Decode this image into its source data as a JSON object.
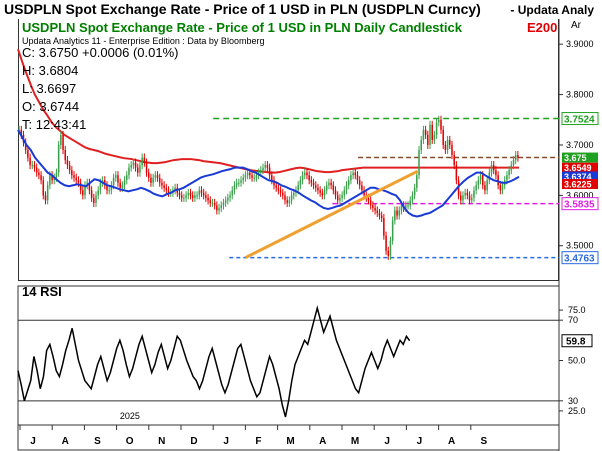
{
  "header": {
    "title": "USDPLN Spot Exchange Rate - Price of 1 USD in PLN (USDPLN Curncy)",
    "right_text": "- Updata Analy"
  },
  "chart": {
    "subtitle": "USDPLN Spot Exchange Rate - Price of 1 USD in PLN Daily Candlestick",
    "badge": "E200",
    "meta": "Updata Analytics 11 - Enterprise Edition : Data by Bloomberg",
    "corner": "Ar",
    "ohlc": [
      "C: 3.6750   +0.0006 (0.01%)",
      "H: 3.6804",
      "L: 3.6697",
      "O: 3.6744",
      "T: 12:43:41"
    ],
    "rsi_title": "14 RSI"
  },
  "colors": {
    "up": "#3aa04a",
    "down": "#e00000",
    "ma_fast": "#1a3ad6",
    "ma_slow": "#e02020",
    "trendline": "#f0a030",
    "resistance": "#20a020",
    "lower_resistance": "#8a4a2a",
    "support_magenta": "#e020e0",
    "support_blue": "#2a6ae0"
  },
  "chart_data": [
    {
      "type": "candlestick",
      "title": "USDPLN Spot Exchange Rate - Price of 1 USD in PLN Daily Candlestick",
      "ylim": [
        3.43,
        3.95
      ],
      "y_ticks": [
        3.5,
        3.6,
        3.7,
        3.8,
        3.9
      ],
      "y_tick_labels": [
        "3.5000",
        "3.6000",
        "3.7000",
        "3.8000",
        "3.9000"
      ],
      "x_months": [
        "J",
        "A",
        "S",
        "O",
        "N",
        "D",
        "J",
        "F",
        "M",
        "A",
        "M",
        "J",
        "J",
        "A",
        "S"
      ],
      "year_label": "2025",
      "levels": [
        {
          "name": "resistance",
          "value": 3.7524,
          "label": "3.7524"
        },
        {
          "name": "lower-resistance",
          "value": 3.675
        },
        {
          "name": "support-magenta",
          "value": 3.5835,
          "label": "3.5835"
        },
        {
          "name": "support-blue",
          "value": 3.4763,
          "label": "3.4763"
        }
      ],
      "price_labels": [
        {
          "value": "3.675",
          "color": "#20a020"
        },
        {
          "value": "3.6549",
          "color": "#e00000"
        },
        {
          "value": "3.6374",
          "color": "#1a3ad6"
        },
        {
          "value": "3.6225",
          "color": "#e00000"
        }
      ],
      "trendline": {
        "from": {
          "month_index": 7.0,
          "value": 3.4763
        },
        "to": {
          "month_index": 12.35,
          "value": 3.648
        }
      },
      "close_series": {
        "start_month_index": 0,
        "step_months": 0.045,
        "values": [
          3.73,
          3.72,
          3.705,
          3.69,
          3.675,
          3.66,
          3.66,
          3.655,
          3.645,
          3.64,
          3.63,
          3.6,
          3.59,
          3.62,
          3.64,
          3.63,
          3.635,
          3.645,
          3.7,
          3.72,
          3.69,
          3.67,
          3.66,
          3.65,
          3.64,
          3.635,
          3.63,
          3.625,
          3.61,
          3.6,
          3.62,
          3.625,
          3.61,
          3.595,
          3.585,
          3.6,
          3.61,
          3.625,
          3.63,
          3.62,
          3.61,
          3.61,
          3.62,
          3.635,
          3.64,
          3.625,
          3.615,
          3.62,
          3.63,
          3.64,
          3.655,
          3.66,
          3.665,
          3.655,
          3.645,
          3.66,
          3.675,
          3.665,
          3.645,
          3.635,
          3.625,
          3.635,
          3.64,
          3.635,
          3.625,
          3.62,
          3.615,
          3.61,
          3.605,
          3.605,
          3.61,
          3.615,
          3.605,
          3.6,
          3.595,
          3.595,
          3.6,
          3.605,
          3.6,
          3.595,
          3.6,
          3.6,
          3.61,
          3.605,
          3.6,
          3.595,
          3.59,
          3.585,
          3.585,
          3.58,
          3.57,
          3.575,
          3.58,
          3.585,
          3.59,
          3.595,
          3.6,
          3.61,
          3.62,
          3.625,
          3.625,
          3.63,
          3.635,
          3.64,
          3.645,
          3.64,
          3.635,
          3.635,
          3.64,
          3.645,
          3.65,
          3.655,
          3.66,
          3.655,
          3.64,
          3.63,
          3.62,
          3.615,
          3.61,
          3.605,
          3.6,
          3.59,
          3.585,
          3.59,
          3.6,
          3.605,
          3.61,
          3.62,
          3.63,
          3.64,
          3.645,
          3.64,
          3.63,
          3.625,
          3.62,
          3.615,
          3.61,
          3.605,
          3.6,
          3.61,
          3.62,
          3.625,
          3.62,
          3.61,
          3.6,
          3.59,
          3.595,
          3.6,
          3.61,
          3.62,
          3.63,
          3.64,
          3.645,
          3.64,
          3.63,
          3.62,
          3.61,
          3.6,
          3.595,
          3.59,
          3.58,
          3.575,
          3.57,
          3.565,
          3.56,
          3.555,
          3.52,
          3.49,
          3.48,
          3.51,
          3.55,
          3.57,
          3.56,
          3.57,
          3.58,
          3.575,
          3.58,
          3.58,
          3.59,
          3.6,
          3.615,
          3.64,
          3.69,
          3.71,
          3.73,
          3.72,
          3.7,
          3.74,
          3.71,
          3.72,
          3.745,
          3.75,
          3.73,
          3.7,
          3.69,
          3.71,
          3.7,
          3.68,
          3.66,
          3.63,
          3.6,
          3.59,
          3.6,
          3.605,
          3.6,
          3.59,
          3.595,
          3.61,
          3.62,
          3.63,
          3.64,
          3.62,
          3.61,
          3.63,
          3.645,
          3.66,
          3.65,
          3.64,
          3.62,
          3.61,
          3.62,
          3.63,
          3.64,
          3.65,
          3.66,
          3.67,
          3.68,
          3.675
        ]
      },
      "ma_fast_series": [
        3.73,
        3.715,
        3.7,
        3.69,
        3.675,
        3.665,
        3.655,
        3.645,
        3.64,
        3.632,
        3.625,
        3.62,
        3.618,
        3.62,
        3.622,
        3.62,
        3.618,
        3.625,
        3.632,
        3.63,
        3.625,
        3.62,
        3.618,
        3.615,
        3.612,
        3.61,
        3.608,
        3.61,
        3.612,
        3.615,
        3.612,
        3.608,
        3.603,
        3.6,
        3.598,
        3.602,
        3.605,
        3.61,
        3.612,
        3.615,
        3.62,
        3.625,
        3.63,
        3.635,
        3.638,
        3.64,
        3.642,
        3.645,
        3.648,
        3.65,
        3.652,
        3.655,
        3.655,
        3.655,
        3.652,
        3.648,
        3.645,
        3.64,
        3.635,
        3.63,
        3.628,
        3.625,
        3.62,
        3.617,
        3.613,
        3.61,
        3.606,
        3.6,
        3.595,
        3.59,
        3.586,
        3.58,
        3.575,
        3.573,
        3.575,
        3.578,
        3.58,
        3.585,
        3.59,
        3.595,
        3.6,
        3.605,
        3.61,
        3.615,
        3.615,
        3.612,
        3.61,
        3.607,
        3.603,
        3.6,
        3.59,
        3.575,
        3.565,
        3.56,
        3.558,
        3.56,
        3.563,
        3.565,
        3.57,
        3.575,
        3.58,
        3.59,
        3.6,
        3.61,
        3.62,
        3.628,
        3.635,
        3.64,
        3.645,
        3.645,
        3.64,
        3.635,
        3.63,
        3.628,
        3.625,
        3.625,
        3.628,
        3.632,
        3.637
      ],
      "ma_slow_series": [
        3.89,
        3.865,
        3.842,
        3.82,
        3.8,
        3.785,
        3.77,
        3.758,
        3.745,
        3.735,
        3.728,
        3.72,
        3.715,
        3.71,
        3.705,
        3.7,
        3.695,
        3.692,
        3.69,
        3.688,
        3.685,
        3.682,
        3.68,
        3.678,
        3.676,
        3.674,
        3.673,
        3.672,
        3.67,
        3.668,
        3.666,
        3.665,
        3.664,
        3.664,
        3.665,
        3.666,
        3.668,
        3.67,
        3.671,
        3.672,
        3.672,
        3.672,
        3.671,
        3.67,
        3.668,
        3.667,
        3.666,
        3.665,
        3.664,
        3.662,
        3.66,
        3.658,
        3.656,
        3.654,
        3.652,
        3.65,
        3.649,
        3.648,
        3.647,
        3.646,
        3.645,
        3.645,
        3.646,
        3.648,
        3.65,
        3.652,
        3.654,
        3.655,
        3.654,
        3.652,
        3.65,
        3.648,
        3.647,
        3.646,
        3.646,
        3.647,
        3.648,
        3.65,
        3.651,
        3.652,
        3.653,
        3.654,
        3.655,
        3.655,
        3.655,
        3.655,
        3.655,
        3.655,
        3.655,
        3.655,
        3.655,
        3.655,
        3.655,
        3.655,
        3.655,
        3.655,
        3.655,
        3.655,
        3.655,
        3.655,
        3.655,
        3.655,
        3.655,
        3.655,
        3.655,
        3.655,
        3.655,
        3.655,
        3.655,
        3.655,
        3.655,
        3.655,
        3.655,
        3.655,
        3.655,
        3.655,
        3.655,
        3.655,
        3.655,
        3.655
      ]
    },
    {
      "type": "line",
      "title": "14 RSI",
      "ylim": [
        18,
        82
      ],
      "y_ticks": [
        25,
        30,
        50,
        70,
        75
      ],
      "y_tick_labels": [
        "25.0",
        "30",
        "50.0",
        "70",
        "75.0"
      ],
      "hlines": [
        30,
        70
      ],
      "last_value_label": "59.8",
      "values": [
        45,
        38,
        30,
        35,
        40,
        52,
        45,
        36,
        42,
        55,
        58,
        52,
        45,
        42,
        48,
        55,
        60,
        66,
        58,
        50,
        45,
        40,
        38,
        36,
        42,
        48,
        52,
        46,
        40,
        44,
        50,
        56,
        60,
        55,
        48,
        42,
        46,
        52,
        58,
        62,
        56,
        50,
        44,
        48,
        54,
        58,
        52,
        46,
        50,
        56,
        62,
        60,
        55,
        50,
        46,
        42,
        40,
        36,
        40,
        46,
        52,
        56,
        50,
        44,
        38,
        34,
        38,
        44,
        50,
        56,
        58,
        52,
        46,
        40,
        36,
        32,
        34,
        40,
        46,
        52,
        48,
        42,
        36,
        28,
        22,
        30,
        40,
        48,
        52,
        56,
        60,
        58,
        64,
        70,
        76,
        70,
        64,
        68,
        72,
        66,
        60,
        56,
        52,
        48,
        44,
        40,
        36,
        34,
        40,
        46,
        50,
        54,
        50,
        46,
        50,
        56,
        60,
        56,
        52,
        56,
        60,
        58,
        62,
        59.8
      ]
    }
  ]
}
